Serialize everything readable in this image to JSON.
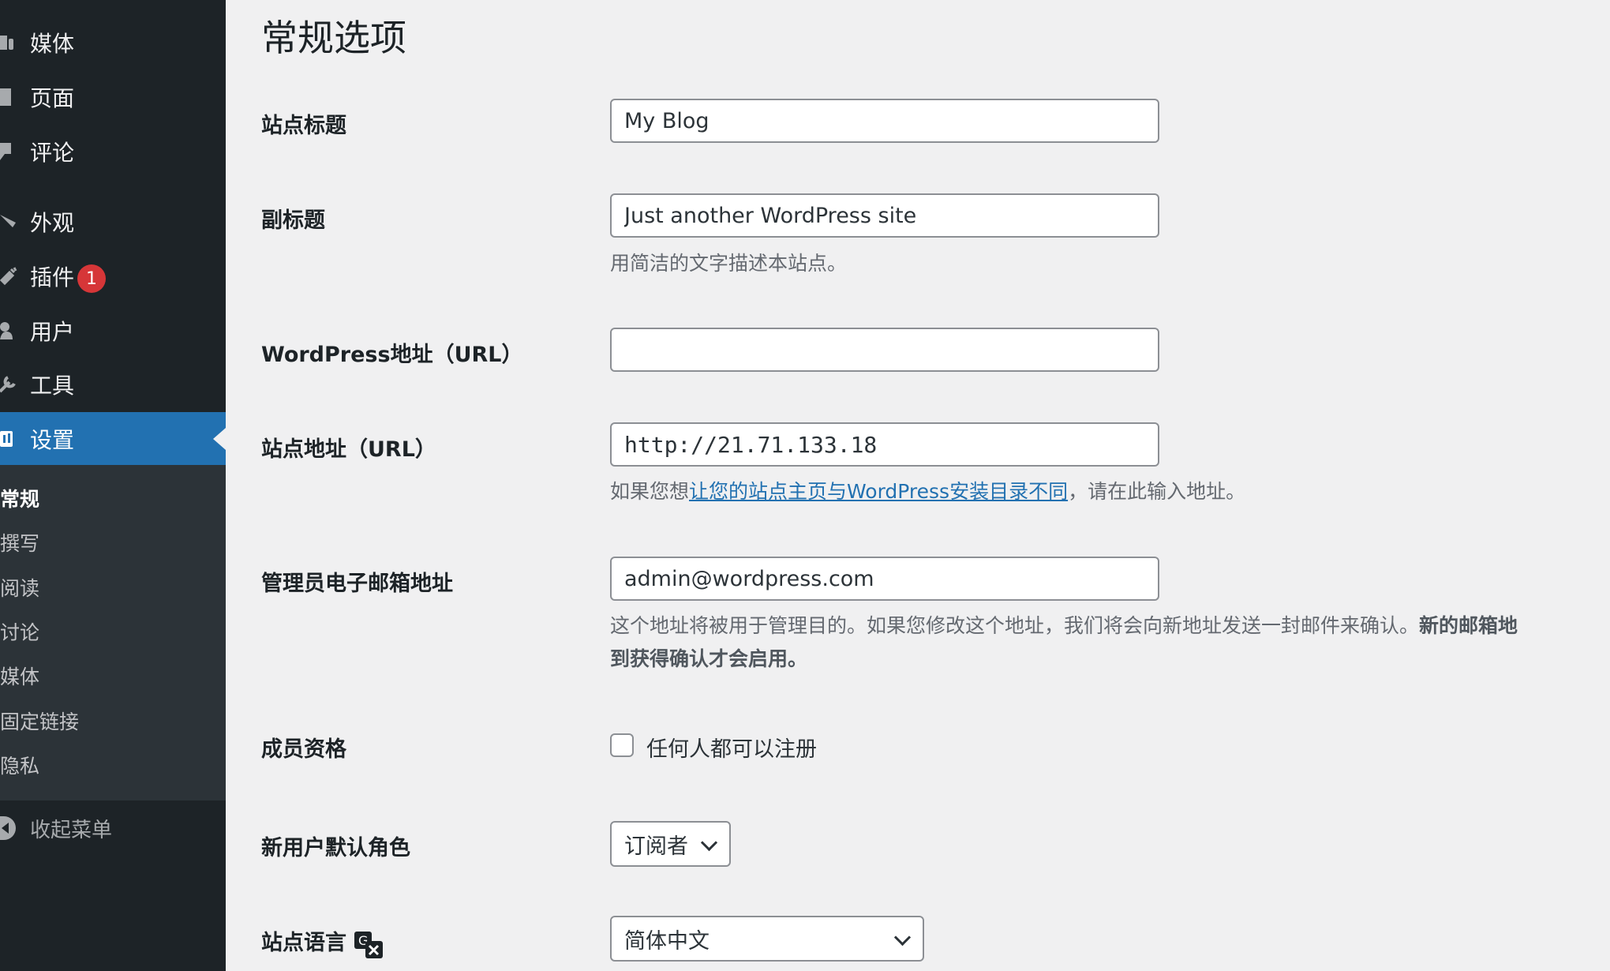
{
  "sidebar": {
    "items": [
      {
        "label": "媒体",
        "icon": "media-icon"
      },
      {
        "label": "页面",
        "icon": "page-icon"
      },
      {
        "label": "评论",
        "icon": "comment-icon"
      },
      {
        "label": "外观",
        "icon": "appearance-icon"
      },
      {
        "label": "插件",
        "icon": "plugin-icon",
        "badge": "1"
      },
      {
        "label": "用户",
        "icon": "user-icon"
      },
      {
        "label": "工具",
        "icon": "tools-icon"
      },
      {
        "label": "设置",
        "icon": "settings-icon",
        "active": true
      }
    ],
    "submenu": [
      "常规",
      "撰写",
      "阅读",
      "讨论",
      "媒体",
      "固定链接",
      "隐私"
    ],
    "collapse_label": "收起菜单"
  },
  "main": {
    "title": "常规选项",
    "site_title": {
      "label": "站点标题",
      "value": "My Blog"
    },
    "tagline": {
      "label": "副标题",
      "value": "Just another WordPress site",
      "description": "用简洁的文字描述本站点。"
    },
    "wp_url": {
      "label": "WordPress地址（URL）",
      "value": ""
    },
    "site_url": {
      "label": "站点地址（URL）",
      "value": "http://21.71.133.18",
      "desc_prefix": "如果您想",
      "desc_link": "让您的站点主页与WordPress安装目录不同",
      "desc_suffix": "，请在此输入地址。"
    },
    "admin_email": {
      "label": "管理员电子邮箱地址",
      "value": "admin@wordpress.com",
      "desc_line1": "这个地址将被用于管理目的。如果您修改这个地址，我们将会向新地址发送一封邮件来确认。",
      "desc_line1_bold": "新的邮箱地",
      "desc_line2_bold": "到获得确认才会启用。"
    },
    "membership": {
      "label": "成员资格",
      "checkbox_label": "任何人都可以注册",
      "checked": false
    },
    "default_role": {
      "label": "新用户默认角色",
      "value": "订阅者"
    },
    "site_language": {
      "label": "站点语言",
      "value": "简体中文",
      "icon": "translation-icon"
    }
  },
  "colors": {
    "sidebar_bg": "#1d2327",
    "submenu_bg": "#2c3338",
    "accent": "#2271b1",
    "badge": "#d63638",
    "page_bg": "#f0f0f1"
  }
}
